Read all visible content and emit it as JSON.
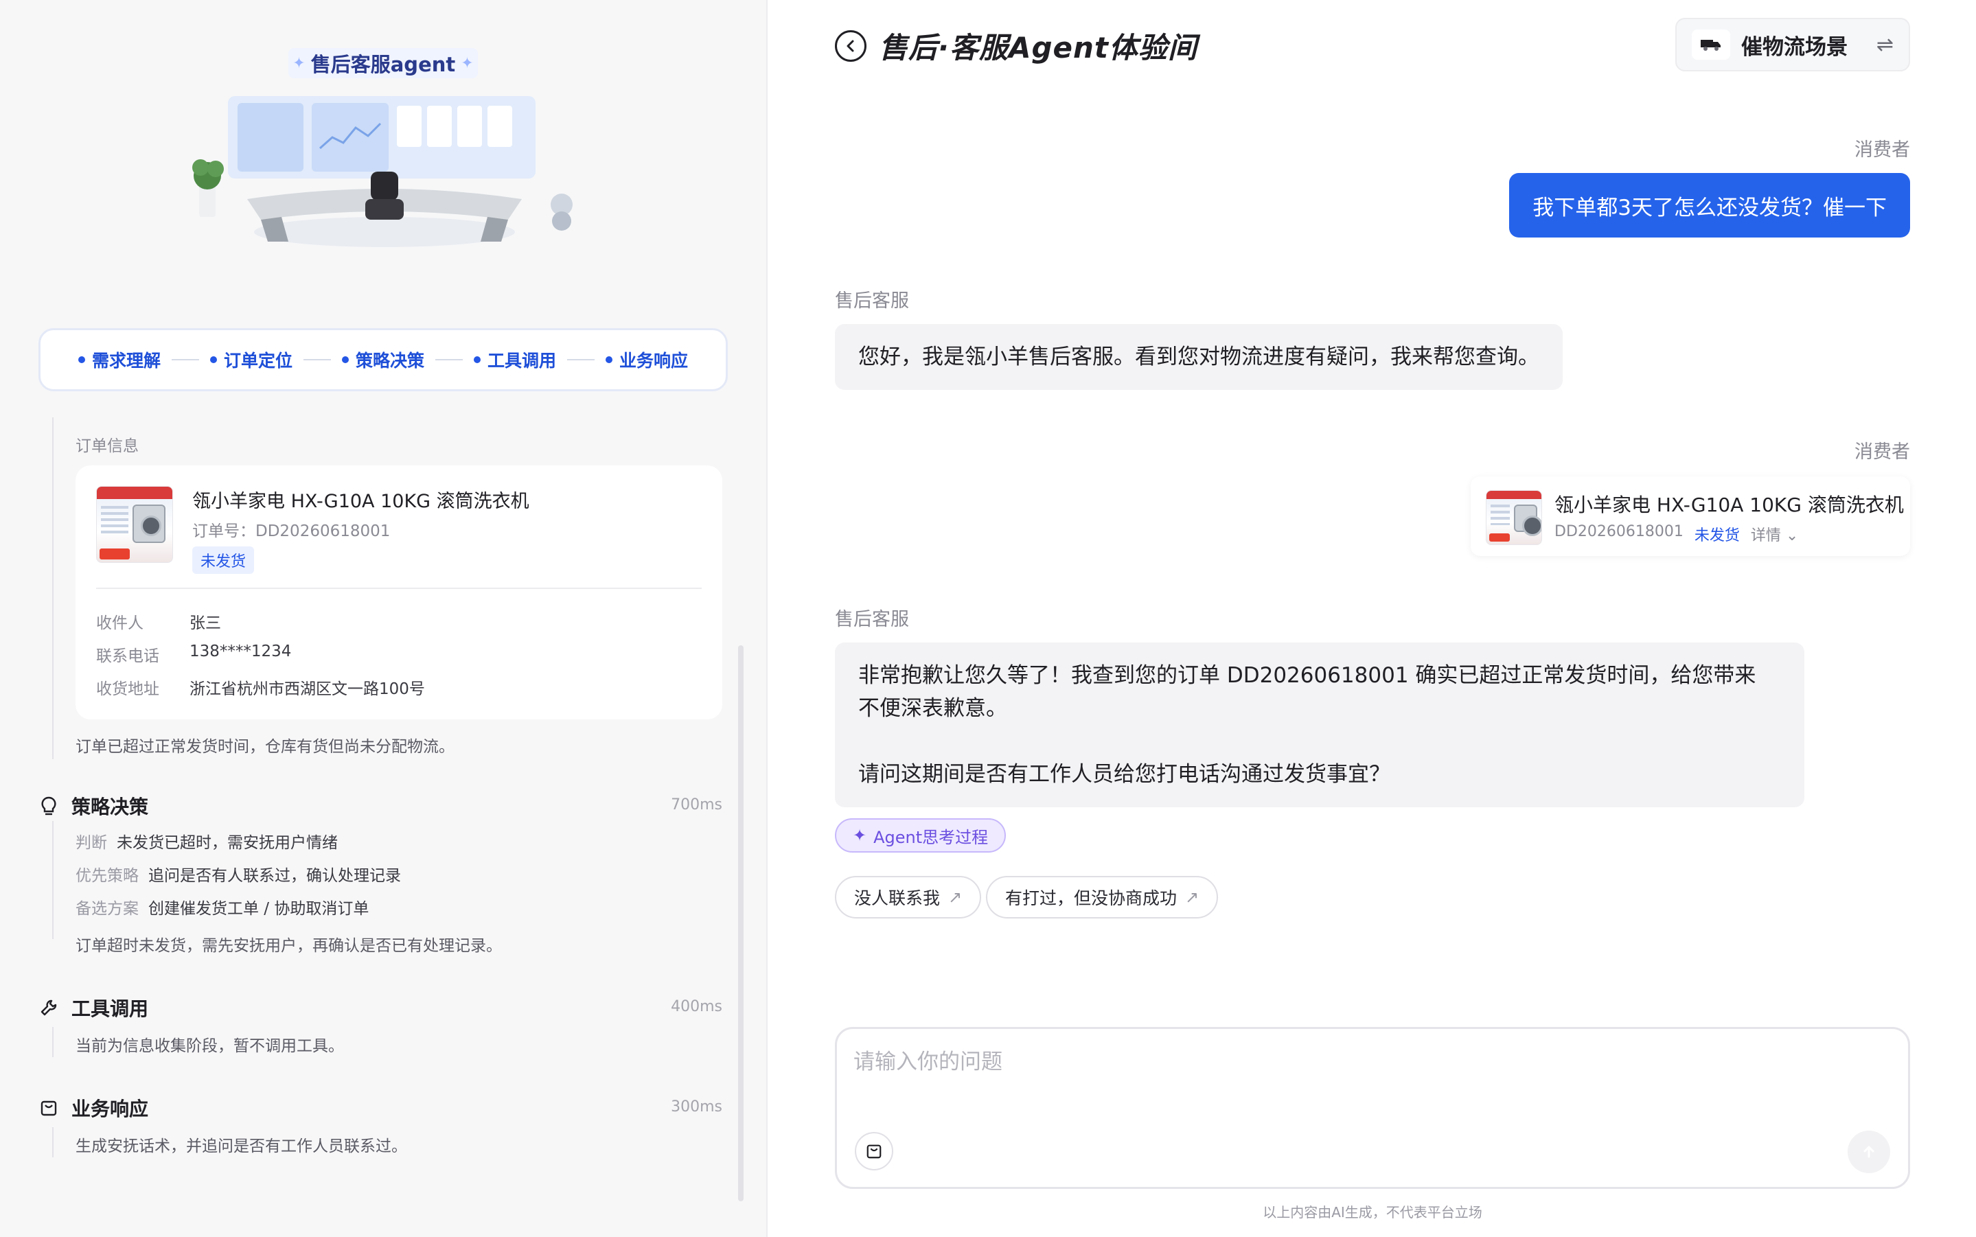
{
  "left": {
    "hero_title": "售后客服agent",
    "steps": [
      "需求理解",
      "订单定位",
      "策略决策",
      "工具调用",
      "业务响应"
    ],
    "order_section": {
      "label": "订单信息",
      "product_title": "瓴小羊家电 HX-G10A 10KG 滚筒洗衣机",
      "order_no": "订单号：DD20260618001",
      "status": "未发货",
      "fields": [
        {
          "k": "收件人",
          "v": "张三"
        },
        {
          "k": "联系电话",
          "v": "138****1234"
        },
        {
          "k": "收货地址",
          "v": "浙江省杭州市西湖区文一路100号"
        }
      ],
      "note": "订单已超过正常发货时间，仓库有货但尚未分配物流。"
    },
    "strategy": {
      "title": "策略决策",
      "ms": "700ms",
      "rows": [
        {
          "k": "判断",
          "v": "未发货已超时，需安抚用户情绪"
        },
        {
          "k": "优先策略",
          "v": "追问是否有人联系过，确认处理记录"
        },
        {
          "k": "备选方案",
          "v": "创建催发货工单 / 协助取消订单"
        }
      ],
      "note": "订单超时未发货，需先安抚用户，再确认是否已有处理记录。"
    },
    "tools": {
      "title": "工具调用",
      "ms": "400ms",
      "note": "当前为信息收集阶段，暂不调用工具。"
    },
    "response": {
      "title": "业务响应",
      "ms": "300ms",
      "note": "生成安抚话术，并追问是否有工作人员联系过。"
    }
  },
  "right": {
    "title": "售后·客服Agent体验间",
    "scene_label": "催物流场景",
    "messages": {
      "consumer_label": "消费者",
      "agent_label": "售后客服",
      "user_1": "我下单都3天了怎么还没发货？催一下",
      "agent_1": "您好，我是瓴小羊售后客服。看到您对物流进度有疑问，我来帮您查询。",
      "product_card": {
        "title": "瓴小羊家电 HX-G10A 10KG 滚筒洗衣机",
        "order_no": "DD20260618001",
        "status": "未发货",
        "detail": "详情"
      },
      "agent_2_line1": "非常抱歉让您久等了！我查到您的订单 DD20260618001 确实已超过正常发货时间，给您带来",
      "agent_2_line2": "不便深表歉意。",
      "agent_2_line3": "请问这期间是否有工作人员给您打电话沟通过发货事宜？"
    },
    "think_label": "Agent思考过程",
    "quick_replies": [
      "没人联系我",
      "有打过，但没协商成功"
    ],
    "input_placeholder": "请输入你的问题",
    "disclaimer": "以上内容由AI生成，不代表平台立场"
  },
  "colors": {
    "accent": "#2563eb",
    "step_blue": "#1e4fd8",
    "think_purple": "#6b4fe0"
  }
}
